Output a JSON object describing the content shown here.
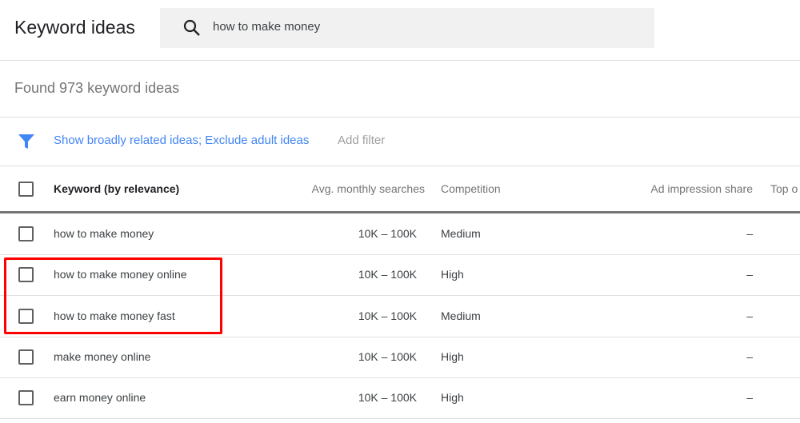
{
  "header": {
    "title": "Keyword ideas",
    "search_value": "how to make money"
  },
  "summary": "Found 973 keyword ideas",
  "filter": {
    "applied": "Show broadly related ideas; Exclude adult ideas",
    "add": "Add filter"
  },
  "table": {
    "columns": [
      "Keyword (by relevance)",
      "Avg. monthly searches",
      "Competition",
      "Ad impression share",
      "Top o"
    ],
    "rows": [
      {
        "keyword": "how to make money",
        "searches": "10K – 100K",
        "competition": "Medium",
        "share": "–"
      },
      {
        "keyword": "how to make money online",
        "searches": "10K – 100K",
        "competition": "High",
        "share": "–"
      },
      {
        "keyword": "how to make money fast",
        "searches": "10K – 100K",
        "competition": "Medium",
        "share": "–"
      },
      {
        "keyword": "make money online",
        "searches": "10K – 100K",
        "competition": "High",
        "share": "–"
      },
      {
        "keyword": "earn money online",
        "searches": "10K – 100K",
        "competition": "High",
        "share": "–"
      }
    ]
  },
  "colors": {
    "accent": "#4285f4",
    "highlight": "#ff0000"
  }
}
